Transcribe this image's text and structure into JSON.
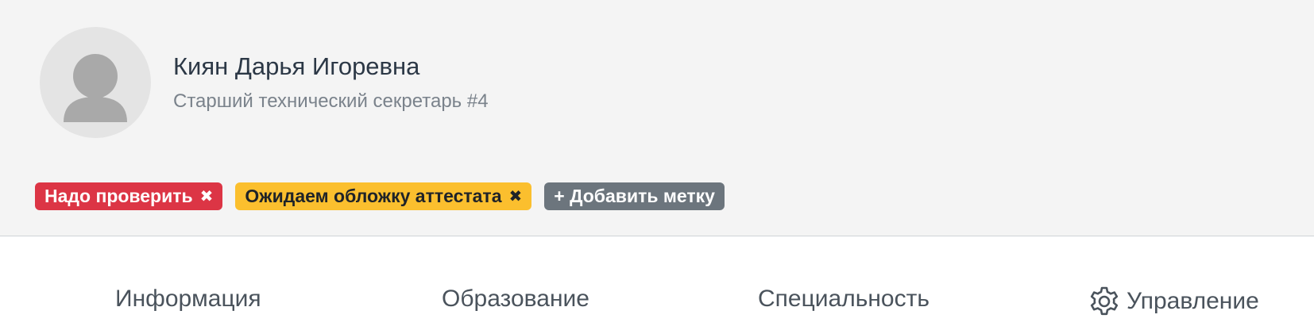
{
  "profile": {
    "name": "Киян Дарья Игоревна",
    "role": "Старший технический секретарь #4"
  },
  "tags": [
    {
      "label": "Надо проверить",
      "remove": "✖",
      "color": "#dc3545"
    },
    {
      "label": "Ожидаем обложку аттестата",
      "remove": "✖",
      "color": "#fbbf2e"
    },
    {
      "label": "+ Добавить метку",
      "color": "#6c757d"
    }
  ],
  "tabs": [
    {
      "label": "Информация"
    },
    {
      "label": "Образование"
    },
    {
      "label": "Специальность"
    },
    {
      "label": "Управление",
      "icon": "gear-icon"
    }
  ],
  "colors": {
    "header_bg": "#f4f4f4",
    "text_primary": "#2c3846",
    "text_secondary": "#7a828b"
  }
}
